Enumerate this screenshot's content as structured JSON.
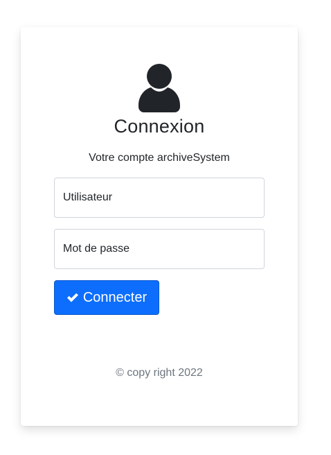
{
  "login": {
    "title": "Connexion",
    "subtitle": "Votre compte archiveSystem",
    "username_placeholder": "Utilisateur",
    "password_placeholder": "Mot de passe",
    "submit_label": "Connecter",
    "submit_icon": "check-icon",
    "avatar_icon": "user-icon",
    "footer": "© copy right 2022"
  },
  "colors": {
    "primary": "#0d6efd",
    "text": "#212529",
    "muted": "#6c757d",
    "border": "#ced4da"
  }
}
